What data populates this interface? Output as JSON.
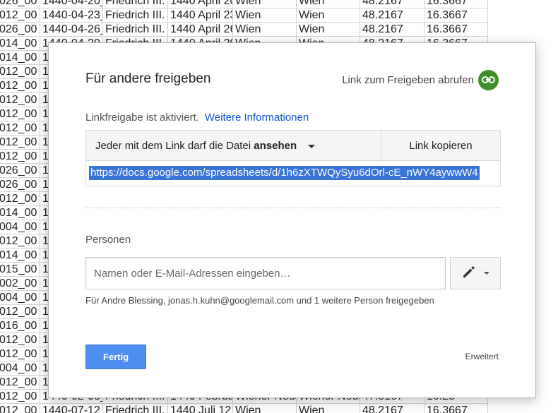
{
  "sheet": {
    "rows": [
      [
        "026_00",
        "1440-04-20_",
        "Friedrich III.",
        "1440 April 20",
        "Wien",
        "Wien",
        "48.2167",
        "16.3667"
      ],
      [
        "012_00",
        "1440-04-23_",
        "Friedrich III.",
        "1440 April 23",
        "Wien",
        "Wien",
        "48.2167",
        "16.3667"
      ],
      [
        "026_00",
        "1440-04-26_",
        "Friedrich III.",
        "1440 April 26",
        "Wien",
        "Wien",
        "48.2167",
        "16.3667"
      ],
      [
        "014_00",
        "1440-04-29_",
        "Friedrich III.",
        "1440 April 29",
        "Wien",
        "Wien",
        "48.2167",
        "16.3667"
      ],
      [
        "014_00",
        "1",
        "",
        "",
        "",
        "",
        "",
        ""
      ],
      [
        "012_00",
        "1",
        "",
        "",
        "",
        "",
        "",
        ""
      ],
      [
        "012_00",
        "1",
        "",
        "",
        "",
        "",
        "",
        ""
      ],
      [
        "012_00",
        "1",
        "",
        "",
        "",
        "",
        "",
        ""
      ],
      [
        "012_00",
        "1",
        "",
        "",
        "",
        "",
        "",
        ""
      ],
      [
        "012_00",
        "1",
        "",
        "",
        "",
        "",
        "",
        ""
      ],
      [
        "012_00",
        "1",
        "",
        "",
        "",
        "",
        "",
        ""
      ],
      [
        "012_00",
        "1",
        "",
        "",
        "",
        "",
        "",
        ""
      ],
      [
        "026_00",
        "1",
        "",
        "",
        "",
        "",
        "",
        ""
      ],
      [
        "026_00",
        "1",
        "",
        "",
        "",
        "",
        "",
        ""
      ],
      [
        "012_00",
        "1",
        "",
        "",
        "",
        "",
        "",
        ""
      ],
      [
        "014_00",
        "1",
        "",
        "",
        "",
        "",
        "",
        ""
      ],
      [
        "004_00",
        "1",
        "",
        "",
        "",
        "",
        "",
        ""
      ],
      [
        "012_00",
        "1",
        "",
        "",
        "",
        "",
        "",
        ""
      ],
      [
        "014_00",
        "1",
        "",
        "",
        "",
        "",
        "",
        ""
      ],
      [
        "015_00",
        "1",
        "",
        "",
        "",
        "",
        "",
        ""
      ],
      [
        "002_00",
        "1",
        "",
        "",
        "",
        "",
        "",
        ""
      ],
      [
        "004_00",
        "1",
        "",
        "",
        "",
        "",
        "",
        ""
      ],
      [
        "012_00",
        "1",
        "",
        "",
        "",
        "",
        "",
        ""
      ],
      [
        "016_00",
        "1",
        "",
        "",
        "",
        "",
        "",
        ""
      ],
      [
        "012_00",
        "1",
        "",
        "",
        "",
        "",
        "",
        ""
      ],
      [
        "012_00",
        "1",
        "",
        "",
        "",
        "",
        "",
        ""
      ],
      [
        "004_00",
        "1",
        "",
        "",
        "",
        "",
        "",
        ""
      ],
      [
        "012_00",
        "1",
        "",
        "",
        "",
        "",
        "",
        ""
      ],
      [
        "012_00",
        "1440-02-08_",
        "Friedrich III.",
        "1440 Februa",
        "Wiener Neus",
        "Wiener Neus",
        "47.8167",
        "16.25"
      ],
      [
        "012_00",
        "1440-07-12_",
        "Friedrich III.",
        "1440 Juli 12",
        "Wien",
        "Wien",
        "48.2167",
        "16.3667"
      ]
    ]
  },
  "dialog": {
    "title": "Für andere freigeben",
    "get_link_label": "Link zum Freigeben abrufen",
    "get_link_icon": "link-icon",
    "accent_green": "#3e8e29",
    "link_status": "Linkfreigabe ist aktiviert.",
    "more_info": "Weitere Informationen",
    "permission_prefix": "Jeder mit dem Link darf die Datei",
    "permission_value": "ansehen",
    "copy_link": "Link kopieren",
    "share_url": "https://docs.google.com/spreadsheets/d/1h6zXTWQySyu6dOrl-cE_nWY4aywwW4",
    "people_label": "Personen",
    "people_placeholder": "Namen oder E-Mail-Adressen eingeben…",
    "edit_icon": "pencil-icon",
    "shared_with": "Für Andre Blessing, jonas.h.kuhn@googlemail.com und 1 weitere Person freigegeben",
    "done_label": "Fertig",
    "advanced_label": "Erweitert",
    "primary_blue": "#4d8ef0"
  }
}
